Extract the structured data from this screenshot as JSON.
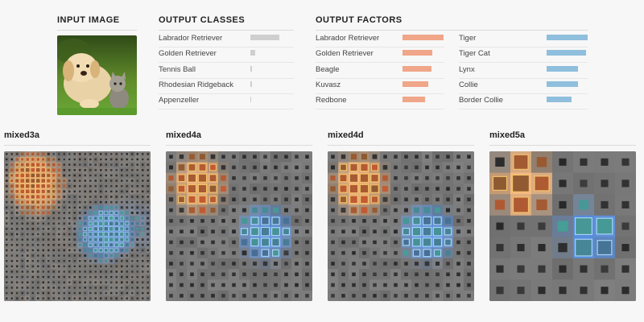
{
  "input": {
    "title": "INPUT IMAGE"
  },
  "classes": {
    "title": "OUTPUT CLASSES",
    "items": [
      {
        "label": "Labrador Retriever",
        "value": 0.95
      },
      {
        "label": "Golden Retriever",
        "value": 0.16
      },
      {
        "label": "Tennis Ball",
        "value": 0.05
      },
      {
        "label": "Rhodesian Ridgeback",
        "value": 0.04
      },
      {
        "label": "Appenzeller",
        "value": 0.03
      }
    ],
    "bar_color": "#cfcfcf"
  },
  "factors": {
    "title": "OUTPUT FACTORS",
    "left": [
      {
        "label": "Labrador Retriever",
        "value": 1.0
      },
      {
        "label": "Golden Retriever",
        "value": 0.72
      },
      {
        "label": "Beagle",
        "value": 0.7
      },
      {
        "label": "Kuvasz",
        "value": 0.62
      },
      {
        "label": "Redbone",
        "value": 0.55
      }
    ],
    "right": [
      {
        "label": "Tiger",
        "value": 1.0
      },
      {
        "label": "Tiger Cat",
        "value": 0.96
      },
      {
        "label": "Lynx",
        "value": 0.76
      },
      {
        "label": "Collie",
        "value": 0.76
      },
      {
        "label": "Border Collie",
        "value": 0.6
      }
    ],
    "orange": "#f0a688",
    "blue": "#8fbfdc"
  },
  "layers": [
    {
      "name": "mixed3a",
      "grid": 28
    },
    {
      "name": "mixed4a",
      "grid": 14
    },
    {
      "name": "mixed4d",
      "grid": 14
    },
    {
      "name": "mixed5a",
      "grid": 7
    }
  ]
}
